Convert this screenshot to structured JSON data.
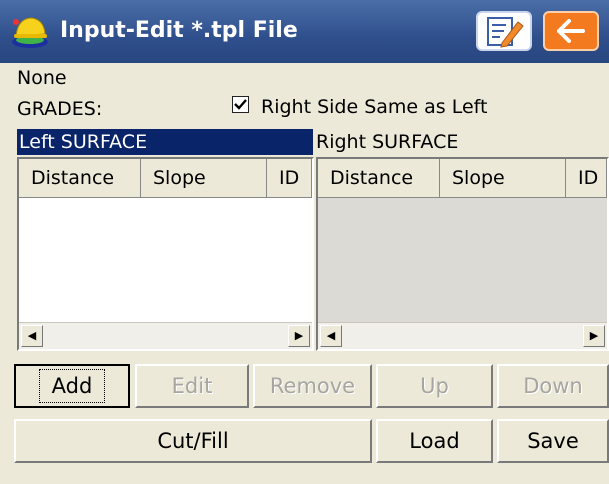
{
  "window": {
    "title": "Input-Edit *.tpl File"
  },
  "status": {
    "none_label": "None",
    "grades_label": "GRADES:"
  },
  "options": {
    "right_same_label": "Right Side Same as Left",
    "right_same_checked": true
  },
  "left_surface": {
    "label": "Left SURFACE",
    "columns": [
      "Distance",
      "Slope",
      "ID"
    ],
    "rows": []
  },
  "right_surface": {
    "label": "Right SURFACE",
    "columns": [
      "Distance",
      "Slope",
      "ID"
    ],
    "rows": []
  },
  "buttons": {
    "add": "Add",
    "edit": "Edit",
    "remove": "Remove",
    "up": "Up",
    "down": "Down",
    "cutfill": "Cut/Fill",
    "load": "Load",
    "save": "Save"
  },
  "icons": {
    "app": "surveyor-hardhat-icon",
    "edit": "edit-pencil-icon",
    "back": "back-arrow-icon"
  },
  "colors": {
    "titlebar": "#2f4f8c",
    "selection": "#0a246a",
    "back_button": "#f47a1f"
  }
}
